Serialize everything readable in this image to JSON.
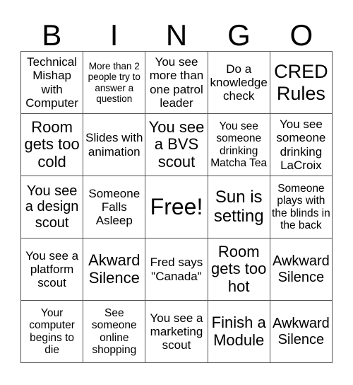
{
  "header": [
    "B",
    "I",
    "N",
    "G",
    "O"
  ],
  "cells": [
    "Technical Mishap with Computer",
    "More than 2 people try to answer a question",
    "You see more than one patrol leader",
    "Do a knowledge check",
    "CRED Rules",
    "Room gets too cold",
    "Slides with animation",
    "You see a BVS scout",
    "You see someone drinking Matcha Tea",
    "You see someone drinking LaCroix",
    "You see a design scout",
    "Someone Falls Asleep",
    "Free!",
    "Sun is setting",
    "Someone plays with the blinds in the back",
    "You see a platform scout",
    "Akward Silence",
    "Fred says \"Canada\"",
    "Room gets too hot",
    "Awkward Silence",
    "Your computer begins to die",
    "See someone online shopping",
    "You see a marketing scout",
    "Finish a Module",
    "Awkward Silence"
  ]
}
